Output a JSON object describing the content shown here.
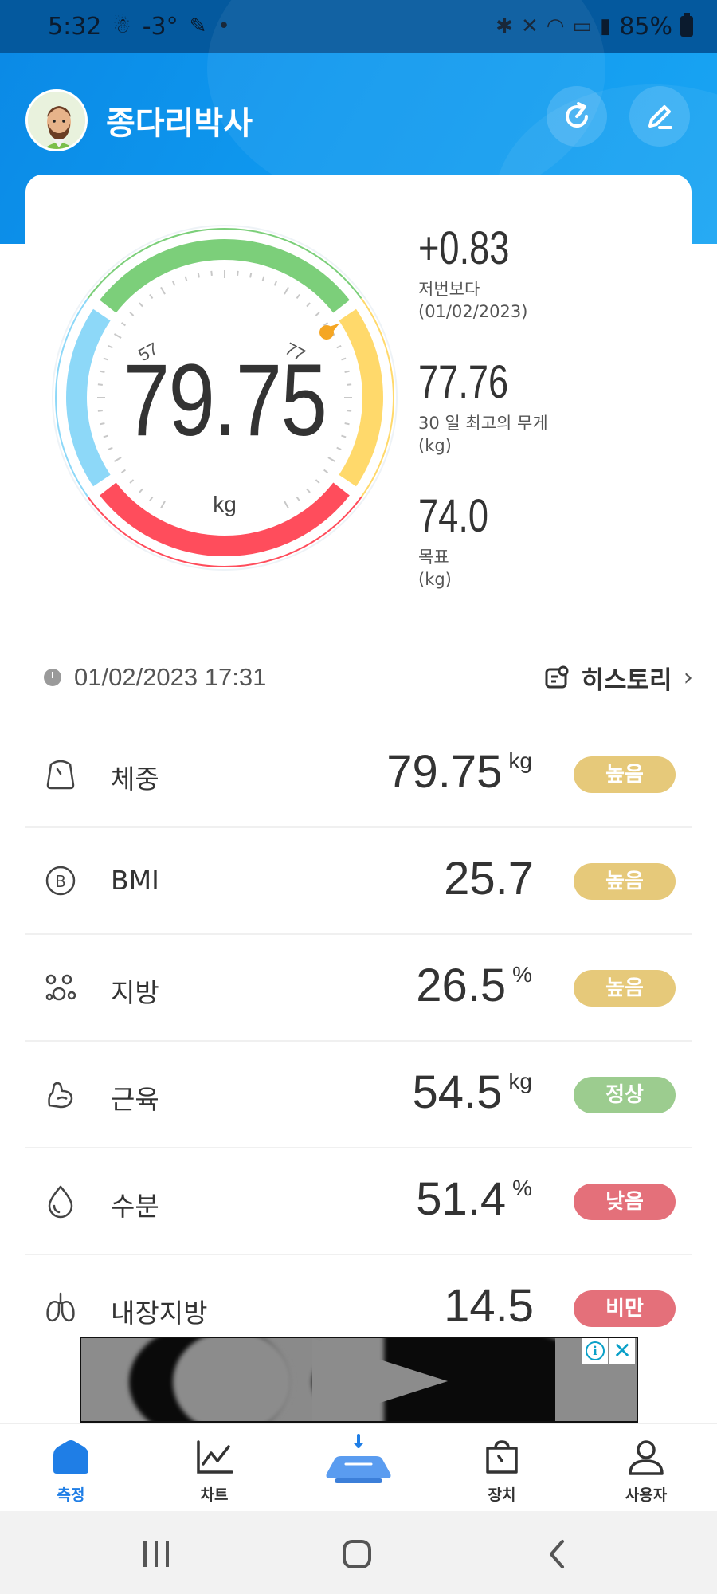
{
  "status_bar": {
    "time": "5:32",
    "temperature": "-3°",
    "battery": "85%"
  },
  "header": {
    "username": "종다리박사"
  },
  "gauge": {
    "weight": "79.75",
    "unit": "kg",
    "tick_left": "57",
    "tick_right": "77",
    "colors": {
      "low": "#8dd8f8",
      "normal": "#7ccf7a",
      "high": "#ffd96b",
      "obese": "#ff4d5c"
    }
  },
  "stats": [
    {
      "value": "+0.83",
      "label_1": "저번보다",
      "label_2": "(01/02/2023)"
    },
    {
      "value": "77.76",
      "label_1": "30 일 최고의 무게",
      "label_2": "(kg)"
    },
    {
      "value": "74.0",
      "label_1": "목표",
      "label_2": "(kg)"
    }
  ],
  "measure": {
    "datetime": "01/02/2023 17:31",
    "history_label": "히스토리"
  },
  "metrics": [
    {
      "name": "체중",
      "value": "79.75",
      "unit": "kg",
      "status": "높음",
      "status_color": "#e6c97a",
      "icon": "weight-icon"
    },
    {
      "name": "BMI",
      "value": "25.7",
      "unit": "",
      "status": "높음",
      "status_color": "#e6c97a",
      "icon": "bmi-icon"
    },
    {
      "name": "지방",
      "value": "26.5",
      "unit": "%",
      "status": "높음",
      "status_color": "#e6c97a",
      "icon": "fat-icon"
    },
    {
      "name": "근육",
      "value": "54.5",
      "unit": "kg",
      "status": "정상",
      "status_color": "#9ccc8f",
      "icon": "muscle-icon"
    },
    {
      "name": "수분",
      "value": "51.4",
      "unit": "%",
      "status": "낮음",
      "status_color": "#e4707a",
      "icon": "water-icon"
    },
    {
      "name": "내장지방",
      "value": "14.5",
      "unit": "",
      "status": "비만",
      "status_color": "#e4707a",
      "icon": "visceral-fat-icon"
    }
  ],
  "bottom_nav": [
    {
      "label": "측정",
      "active": true
    },
    {
      "label": "차트",
      "active": false
    },
    {
      "label": "",
      "active": false
    },
    {
      "label": "장치",
      "active": false
    },
    {
      "label": "사용자",
      "active": false
    }
  ],
  "accent_color": "#1f7ee6"
}
